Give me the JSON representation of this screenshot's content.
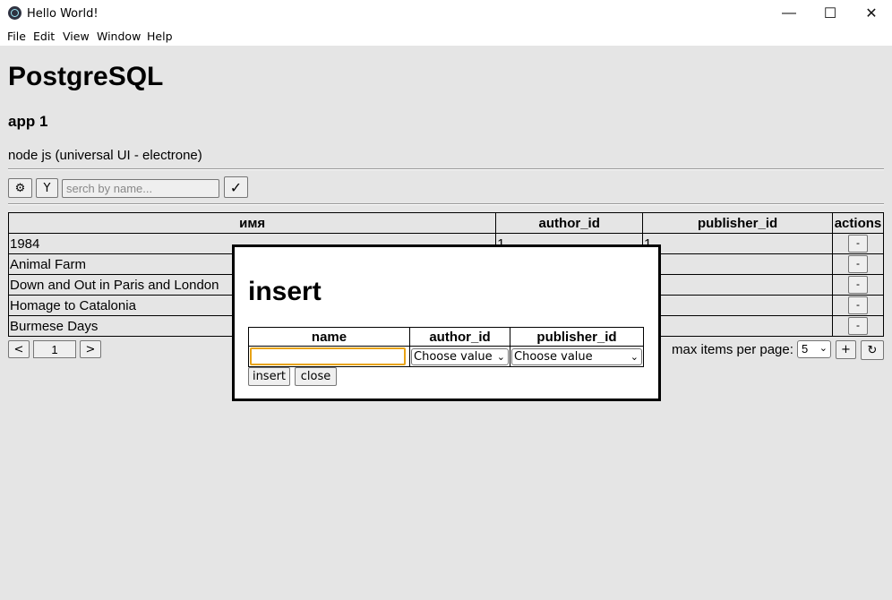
{
  "window": {
    "title": "Hello World!",
    "minimize_glyph": "—",
    "maximize_glyph": "☐",
    "close_glyph": "✕"
  },
  "menu": [
    "File",
    "Edit",
    "View",
    "Window",
    "Help"
  ],
  "page": {
    "title": "PostgreSQL",
    "subtitle": "app 1",
    "description": "node js (universal UI - electrone)"
  },
  "toolbar": {
    "settings_glyph": "⚙",
    "filter_label": "Y",
    "search_placeholder": "serch by name...",
    "search_value": "",
    "confirm_glyph": "✓"
  },
  "table": {
    "columns": [
      "имя",
      "author_id",
      "publisher_id",
      "actions"
    ],
    "rows": [
      {
        "name": "1984",
        "author_id": "1",
        "publisher_id": "1",
        "action": "-"
      },
      {
        "name": "Animal Farm",
        "author_id": "",
        "publisher_id": "",
        "action": "-"
      },
      {
        "name": "Down and Out in Paris and London",
        "author_id": "",
        "publisher_id": "",
        "action": "-"
      },
      {
        "name": "Homage to Catalonia",
        "author_id": "",
        "publisher_id": "",
        "action": "-"
      },
      {
        "name": "Burmese Days",
        "author_id": "",
        "publisher_id": "",
        "action": "-"
      }
    ]
  },
  "pagination": {
    "prev": "<",
    "page": "1",
    "next": ">",
    "max_label": "max items per page:",
    "max_value": "5",
    "add_label": "+",
    "refresh_glyph": "↻"
  },
  "modal": {
    "title": "insert",
    "columns": [
      "name",
      "author_id",
      "publisher_id"
    ],
    "name_value": "",
    "author_select": "Choose value",
    "publisher_select": "Choose value",
    "insert_label": "insert",
    "close_label": "close"
  },
  "colors": {
    "background": "#e5e5e5",
    "focus_ring": "#e8a317",
    "titlebar": "#ffffff"
  }
}
